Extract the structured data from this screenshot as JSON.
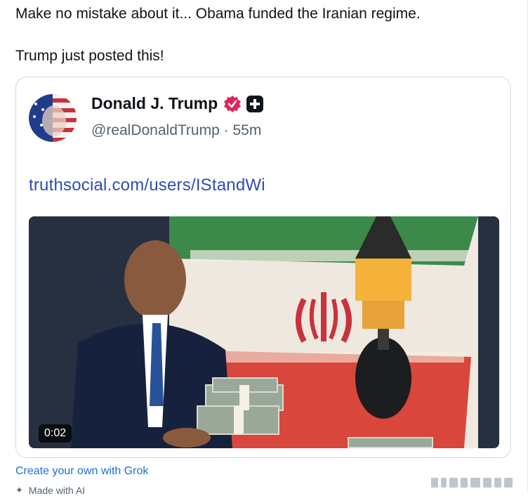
{
  "post": {
    "line1": "Make no mistake about it... Obama funded the Iranian regime.",
    "line2": "Trump just posted this!"
  },
  "quoted": {
    "display_name": "Donald J. Trump",
    "handle": "@realDonaldTrump",
    "separator": "·",
    "time": "55m",
    "link_text": "truthsocial.com/users/IStandWi",
    "video_duration": "0:02"
  },
  "footer": {
    "grok_link": "Create your own with Grok",
    "made_with": "Made with AI"
  },
  "colors": {
    "text": "#0f1419",
    "muted": "#536471",
    "link": "#2b4fb5",
    "grok_link": "#1d6fd1",
    "verified": "#e0245e",
    "border": "#cfd9de"
  },
  "icons": {
    "verified": "verified-badge-icon",
    "plus": "plus-badge-icon",
    "spark": "sparkle-icon"
  }
}
